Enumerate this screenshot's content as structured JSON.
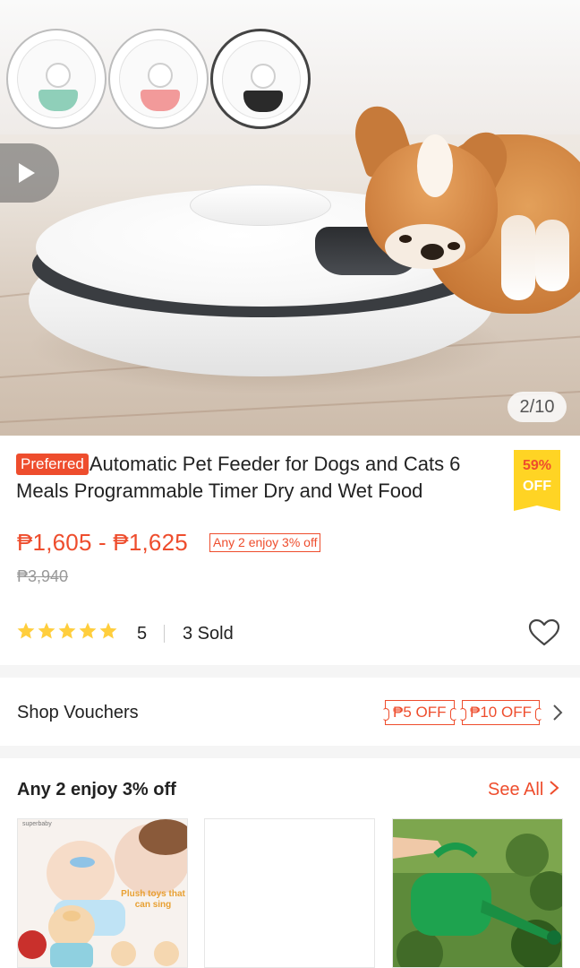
{
  "gallery": {
    "counter": "2/10",
    "variants": [
      {
        "name": "mint",
        "tray_color": "#8fcfb9"
      },
      {
        "name": "pink",
        "tray_color": "#f29a9a"
      },
      {
        "name": "black",
        "tray_color": "#2a2a2a"
      }
    ]
  },
  "product": {
    "badge": "Preferred",
    "title": "Automatic Pet Feeder for Dogs and Cats 6 Meals Programmable Timer Dry and Wet Food",
    "discount_percent": "59%",
    "discount_off": "OFF",
    "price_range": "₱1,605 - ₱1,625",
    "promo_tag": "Any 2 enjoy 3% off",
    "original_price": "₱3,940",
    "rating": "5",
    "rating_stars": 5,
    "sold": "3 Sold"
  },
  "vouchers": {
    "label": "Shop Vouchers",
    "items": [
      "₱5 OFF",
      "₱10 OFF"
    ]
  },
  "bundle": {
    "title": "Any 2 enjoy 3% off",
    "see_all": "See All",
    "card1_caption": "Plush toys that can sing",
    "card1_corner": "superbaby"
  },
  "colors": {
    "accent": "#ee4d2d",
    "star": "#ffce3d",
    "discount_bg": "#ffd424"
  }
}
